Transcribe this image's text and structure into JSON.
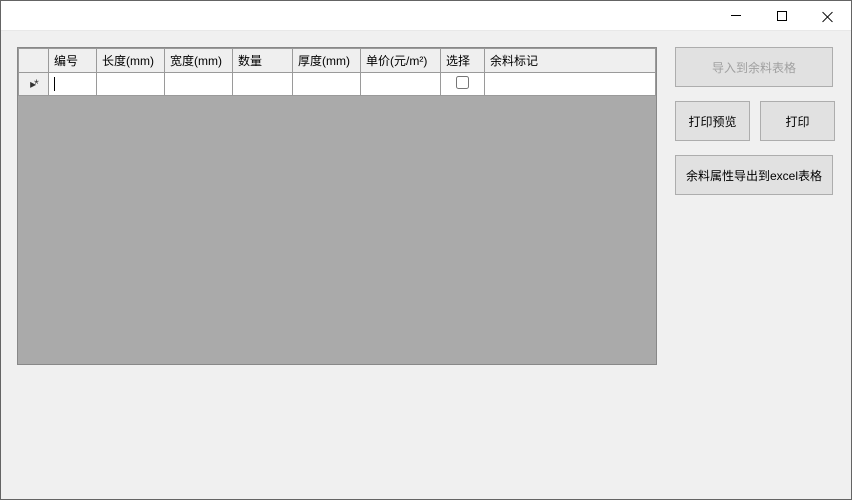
{
  "titlebar": {
    "minimize": "minimize",
    "maximize": "maximize",
    "close": "close"
  },
  "grid": {
    "headers": {
      "row": "",
      "id": "编号",
      "length": "长度(mm)",
      "width": "宽度(mm)",
      "qty": "数量",
      "thickness": "厚度(mm)",
      "price": "单价(元/m²)",
      "select": "选择",
      "mark": "余料标记"
    },
    "newrow_glyph": "▸*",
    "rows": [
      {
        "id": "",
        "length": "",
        "width": "",
        "qty": "",
        "thickness": "",
        "price": "",
        "select": false,
        "mark": ""
      }
    ]
  },
  "sidebar": {
    "import_label": "导入到余料表格",
    "preview_label": "打印预览",
    "print_label": "打印",
    "export_label": "余料属性导出到excel表格"
  }
}
